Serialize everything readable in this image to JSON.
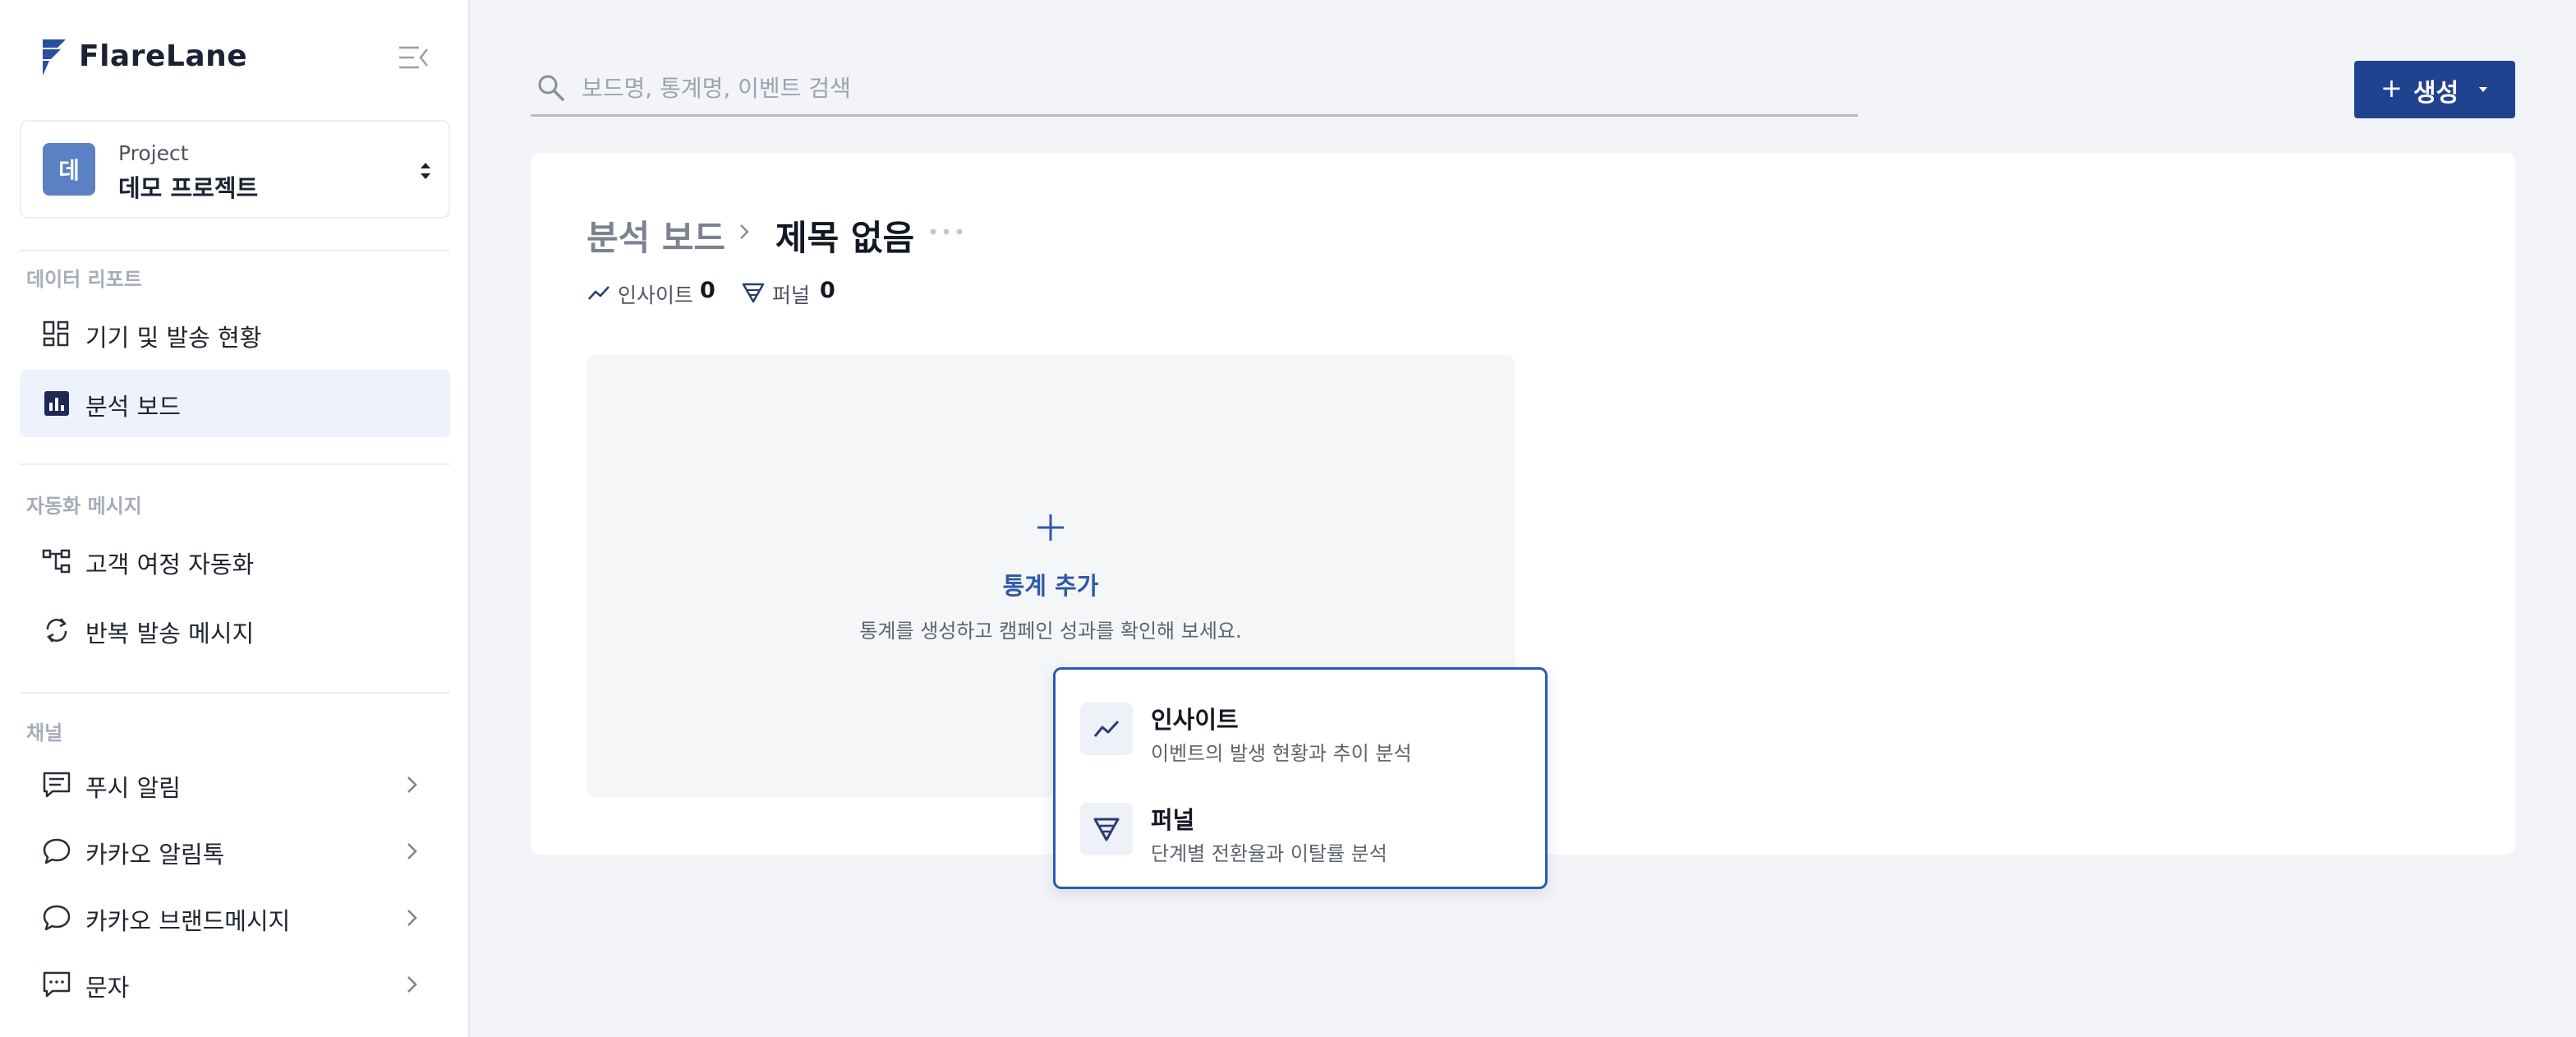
{
  "brand": {
    "name": "FlareLane"
  },
  "project": {
    "label": "Project",
    "name": "데모 프로젝트",
    "avatar_initial": "데"
  },
  "sidebar": {
    "sections": [
      {
        "label": "데이터 리포트",
        "items": [
          {
            "label": "기기 및 발송 현황",
            "icon": "dashboard-grid-icon"
          },
          {
            "label": "분석 보드",
            "icon": "bar-chart-icon",
            "active": true
          }
        ]
      },
      {
        "label": "자동화 메시지",
        "items": [
          {
            "label": "고객 여정 자동화",
            "icon": "journey-flow-icon"
          },
          {
            "label": "반복 발송 메시지",
            "icon": "repeat-icon"
          }
        ]
      },
      {
        "label": "채널",
        "items": [
          {
            "label": "푸시 알림",
            "icon": "push-message-icon"
          },
          {
            "label": "카카오 알림톡",
            "icon": "chat-bubble-icon"
          },
          {
            "label": "카카오 브랜드메시지",
            "icon": "chat-bubble-icon"
          },
          {
            "label": "문자",
            "icon": "sms-icon"
          }
        ]
      }
    ]
  },
  "search": {
    "placeholder": "보드명, 통계명, 이벤트 검색",
    "value": ""
  },
  "create_button": {
    "plus": "+",
    "label": "생성"
  },
  "board": {
    "breadcrumb_parent": "분석 보드",
    "title": "제목 없음",
    "stats": [
      {
        "label": "인사이트",
        "count": "0"
      },
      {
        "label": "퍼널",
        "count": "0"
      }
    ],
    "add_stat": {
      "title": "통계 추가",
      "description": "통계를 생성하고 캠페인 성과를 확인해 보세요."
    }
  },
  "add_menu": {
    "items": [
      {
        "title": "인사이트",
        "description": "이벤트의 발생 현황과 추이 분석",
        "icon": "trend-line-icon"
      },
      {
        "title": "퍼널",
        "description": "단계별 전환율과 이탈률 분석",
        "icon": "funnel-icon"
      }
    ]
  },
  "colors": {
    "accent": "#21438f",
    "avatar": "#5b80c4",
    "active_nav_bg": "#eef2fc",
    "link": "#2f59a8",
    "menu_border": "#2a5ab8"
  }
}
